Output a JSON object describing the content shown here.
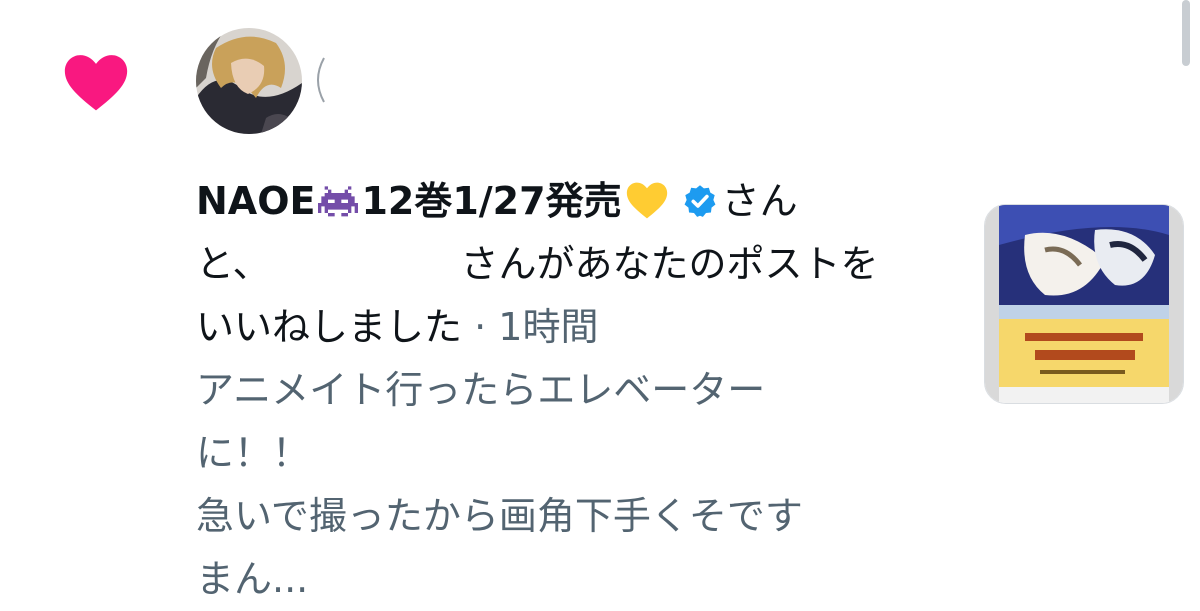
{
  "notification": {
    "type_icon": "heart-icon",
    "accent_color": "#f91880",
    "avatar_icon": "avatar",
    "actor_name": "NAOE",
    "actor_name_tail": "12巻1/27発売",
    "emoji_1": "alien-monster-emoji",
    "emoji_2": "yellow-heart-emoji",
    "verified_icon": "verified-badge-icon",
    "verified_color": "#1d9bf0",
    "text_1": "さん",
    "text_2": "と、",
    "text_3": "さんがあなたのポストを",
    "text_4": "いいねしました",
    "separator": "·",
    "time": "1時間",
    "preview_lines": [
      "アニメイト行ったらエレベーター",
      "に！！",
      "急いで撮ったから画角下手くそです",
      "まん..."
    ],
    "thumbnail_icon": "post-thumbnail-image"
  }
}
